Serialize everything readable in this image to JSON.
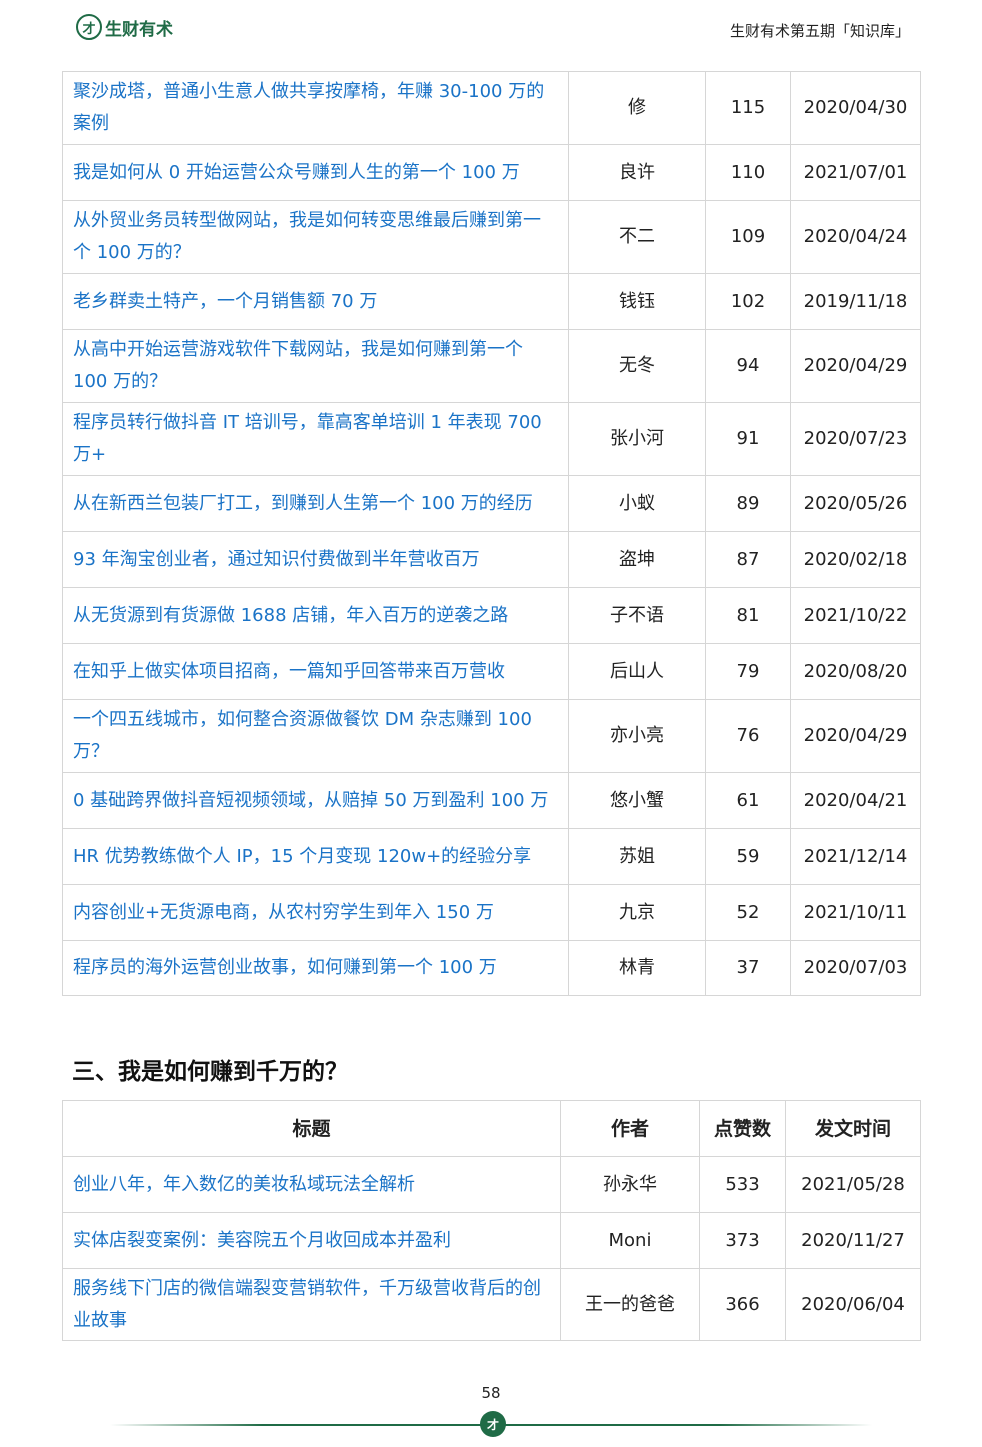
{
  "header": {
    "logo_glyph": "才",
    "logo_text": "生财有术",
    "doc_title": "生财有术第五期「知识库」"
  },
  "table1": {
    "rows": [
      {
        "title": "聚沙成塔，普通小生意人做共享按摩椅，年赚 30-100 万的案例",
        "author": "修",
        "likes": "115",
        "date": "2020/04/30"
      },
      {
        "title": "我是如何从 0 开始运营公众号赚到人生的第一个 100 万",
        "author": "良许",
        "likes": "110",
        "date": "2021/07/01"
      },
      {
        "title": "从外贸业务员转型做网站，我是如何转变思维最后赚到第一个 100 万的？",
        "author": "不二",
        "likes": "109",
        "date": "2020/04/24"
      },
      {
        "title": "老乡群卖土特产，一个月销售额 70 万",
        "author": "钱钰",
        "likes": "102",
        "date": "2019/11/18"
      },
      {
        "title": "从高中开始运营游戏软件下载网站，我是如何赚到第一个 100 万的？",
        "author": "无冬",
        "likes": "94",
        "date": "2020/04/29"
      },
      {
        "title": "程序员转行做抖音 IT 培训号，靠高客单培训 1 年表现 700 万+",
        "author": "张小河",
        "likes": "91",
        "date": "2020/07/23"
      },
      {
        "title": "从在新西兰包装厂打工，到赚到人生第一个 100 万的经历",
        "author": "小蚁",
        "likes": "89",
        "date": "2020/05/26"
      },
      {
        "title": "93 年淘宝创业者，通过知识付费做到半年营收百万",
        "author": "盗坤",
        "likes": "87",
        "date": "2020/02/18"
      },
      {
        "title": "从无货源到有货源做 1688 店铺，年入百万的逆袭之路",
        "author": "子不语",
        "likes": "81",
        "date": "2021/10/22"
      },
      {
        "title": "在知乎上做实体项目招商，一篇知乎回答带来百万营收",
        "author": "后山人",
        "likes": "79",
        "date": "2020/08/20"
      },
      {
        "title": "一个四五线城市，如何整合资源做餐饮 DM 杂志赚到 100 万？",
        "author": "亦小亮",
        "likes": "76",
        "date": "2020/04/29"
      },
      {
        "title": "0 基础跨界做抖音短视频领域，从赔掉 50 万到盈利 100 万",
        "author": "悠小蟹",
        "likes": "61",
        "date": "2020/04/21"
      },
      {
        "title": "HR 优势教练做个人 IP，15 个月变现 120w+的经验分享",
        "author": "苏姐",
        "likes": "59",
        "date": "2021/12/14"
      },
      {
        "title": "内容创业+无货源电商，从农村穷学生到年入 150 万",
        "author": "九京",
        "likes": "52",
        "date": "2021/10/11"
      },
      {
        "title": "程序员的海外运营创业故事，如何赚到第一个 100 万",
        "author": "林青",
        "likes": "37",
        "date": "2020/07/03"
      }
    ]
  },
  "section3": {
    "heading": "三、我是如何赚到千万的？",
    "columns": {
      "title": "标题",
      "author": "作者",
      "likes": "点赞数",
      "date": "发文时间"
    },
    "rows": [
      {
        "title": "创业八年，年入数亿的美妆私域玩法全解析",
        "author": "孙永华",
        "likes": "533",
        "date": "2021/05/28"
      },
      {
        "title": "实体店裂变案例：美容院五个月收回成本并盈利",
        "author": "Moni",
        "likes": "373",
        "date": "2020/11/27"
      },
      {
        "title": "服务线下门店的微信端裂变营销软件，千万级营收背后的创业故事",
        "author": "王一的爸爸",
        "likes": "366",
        "date": "2020/06/04"
      }
    ]
  },
  "footer": {
    "page_number": "58",
    "badge_glyph": "才"
  }
}
